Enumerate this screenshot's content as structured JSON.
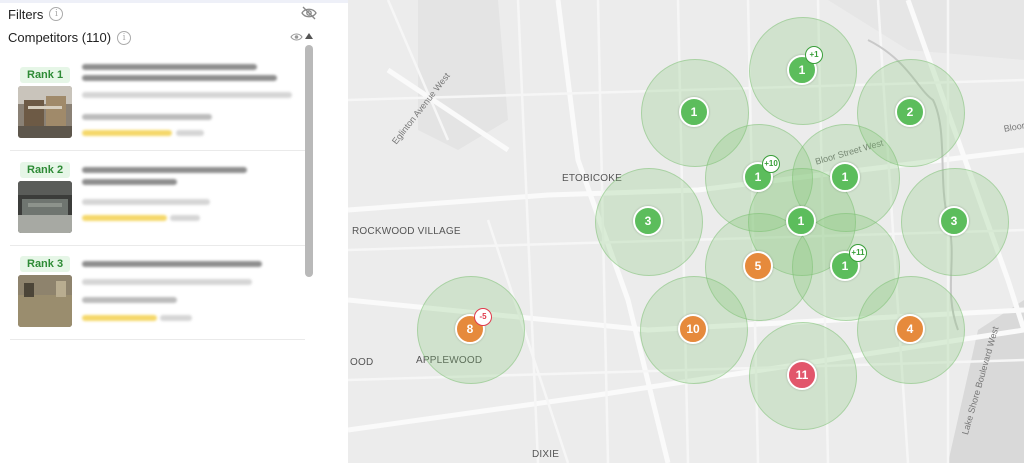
{
  "sidebar": {
    "filters_label": "Filters",
    "competitors_label": "Competitors (110)",
    "cards": [
      {
        "rank": "Rank 1"
      },
      {
        "rank": "Rank 2"
      },
      {
        "rank": "Rank 3"
      }
    ]
  },
  "map": {
    "places": {
      "etobicoke": "ETOBICOKE",
      "rockwood": "ROCKWOOD VILLAGE",
      "applewood": "APPLEWOOD",
      "dixie": "DIXIE",
      "ood": "OOD"
    },
    "streets": {
      "eglinton": "Eglinton Avenue West",
      "bloor": "Bloor Street West",
      "bloor_edge": "Bloor",
      "lakeshore": "Lake Shore Boulevard West"
    },
    "markers": [
      {
        "label": "1",
        "color": "green",
        "delta": "+1"
      },
      {
        "label": "1",
        "color": "green",
        "delta": ""
      },
      {
        "label": "2",
        "color": "green",
        "delta": ""
      },
      {
        "label": "1",
        "color": "green",
        "delta": "+10"
      },
      {
        "label": "1",
        "color": "green",
        "delta": ""
      },
      {
        "label": "3",
        "color": "green",
        "delta": ""
      },
      {
        "label": "1",
        "color": "green",
        "delta": ""
      },
      {
        "label": "3",
        "color": "green",
        "delta": ""
      },
      {
        "label": "5",
        "color": "orange",
        "delta": ""
      },
      {
        "label": "1",
        "color": "green",
        "delta": "+11"
      },
      {
        "label": "8",
        "color": "orange",
        "delta": "-5"
      },
      {
        "label": "10",
        "color": "orange",
        "delta": ""
      },
      {
        "label": "4",
        "color": "orange",
        "delta": ""
      },
      {
        "label": "11",
        "color": "red",
        "delta": ""
      }
    ]
  },
  "colors": {
    "green": "#5cbd5c",
    "orange": "#e68a3c",
    "red": "#e2566b",
    "rank_text": "#2e8b36",
    "rank_bg": "#e6f6e7"
  },
  "icons": {
    "filters_info": "info-icon",
    "filters_visibility": "eye-slash-icon",
    "competitors_info": "info-icon",
    "competitors_visibility": "eye-icon",
    "collapse": "chevron-up-icon"
  }
}
